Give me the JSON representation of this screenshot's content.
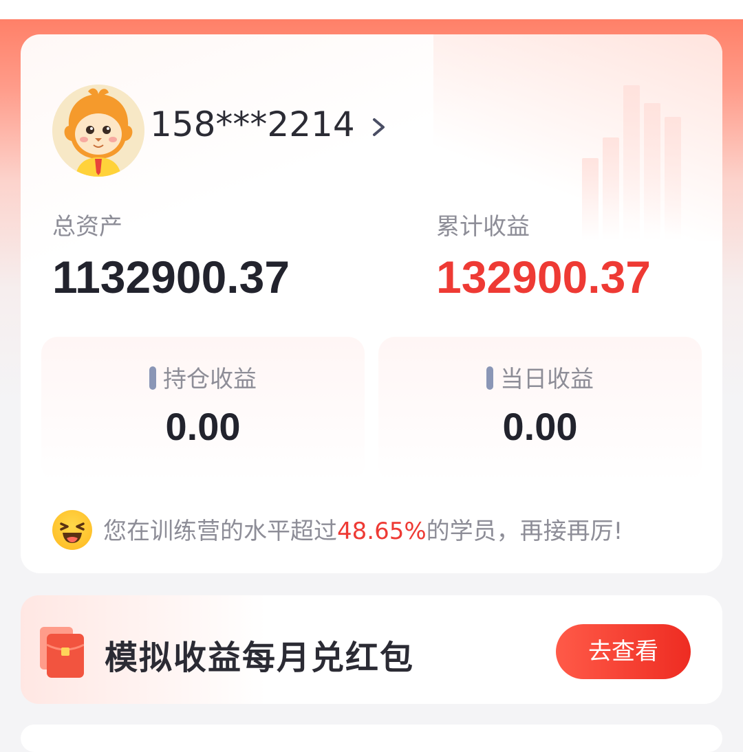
{
  "account": {
    "masked_phone": "158***2214"
  },
  "assets": {
    "total_label": "总资产",
    "total_value": "1132900.37",
    "cumulative_label": "累计收益",
    "cumulative_value": "132900.37",
    "cumulative_color": "#ee3a34"
  },
  "stats": [
    {
      "label": "持仓收益",
      "value": "0.00"
    },
    {
      "label": "当日收益",
      "value": "0.00"
    }
  ],
  "ranking": {
    "prefix": "您在训练营的水平超过",
    "percent": "48.65%",
    "suffix": "的学员，再接再厉!"
  },
  "promo": {
    "title": "模拟收益每月兑红包",
    "button_label": "去查看"
  },
  "icons": [
    "lion-avatar",
    "chevron-right-icon",
    "laughing-emoji-icon",
    "red-envelope-icon"
  ]
}
